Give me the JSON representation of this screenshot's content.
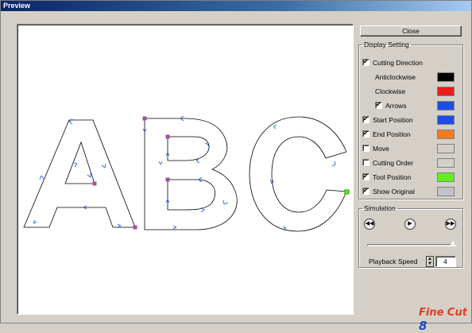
{
  "window": {
    "title": "Preview"
  },
  "buttons": {
    "close": "Close"
  },
  "display_setting": {
    "legend": "Display Setting",
    "items": [
      {
        "label": "Cutting Direction",
        "checked": true,
        "has_checkbox": true,
        "color": null
      },
      {
        "label": "Anticlockwise",
        "has_checkbox": false,
        "color": "#000000"
      },
      {
        "label": "Clockwise",
        "has_checkbox": false,
        "color": "#ee1c1c"
      },
      {
        "label": "Arrows",
        "checked": true,
        "has_checkbox": true,
        "color": "#1e4ce8"
      },
      {
        "label": "Start Position",
        "checked": true,
        "has_checkbox": true,
        "color": "#1e4ce8"
      },
      {
        "label": "End Position",
        "checked": true,
        "has_checkbox": true,
        "color": "#f47b25"
      },
      {
        "label": "Move",
        "checked": false,
        "has_checkbox": true,
        "color": "#d4d0c8"
      },
      {
        "label": "Cutting Order",
        "checked": false,
        "has_checkbox": true,
        "color": "#d4d0c8"
      },
      {
        "label": "Tool Position",
        "checked": true,
        "has_checkbox": true,
        "color": "#5ef01e"
      },
      {
        "label": "Show Original",
        "checked": true,
        "has_checkbox": true,
        "color": "#c0c4c8"
      }
    ]
  },
  "simulation": {
    "legend": "Simulation",
    "playback_label": "Playback Speed",
    "playback_value": "4",
    "slider_position": 1.0
  },
  "logo": {
    "text": "Fine Cut",
    "number": "8"
  }
}
